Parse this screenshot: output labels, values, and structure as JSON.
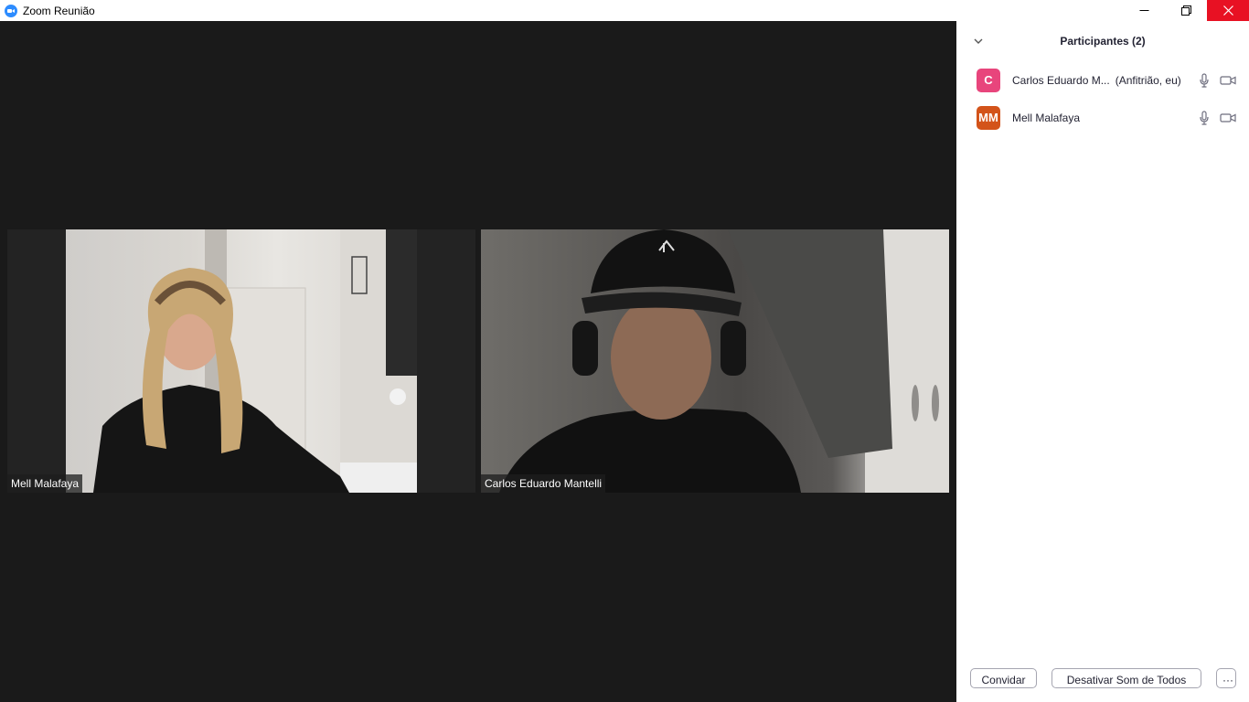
{
  "window": {
    "title": "Zoom Reunião",
    "app_icon": "zoom-camera-icon",
    "controls": [
      "minimize-icon",
      "restore-icon",
      "close-icon"
    ],
    "close_color": "#e81123"
  },
  "gallery": {
    "tiles": [
      {
        "name": "Mell Malafaya"
      },
      {
        "name": "Carlos Eduardo Mantelli"
      }
    ]
  },
  "participants_panel": {
    "title": "Participantes (2)",
    "collapse_icon": "chevron-down-icon",
    "participants": [
      {
        "initials": "C",
        "name": "Carlos Eduardo M...",
        "role": "(Anfitrião, eu)",
        "avatar_color": "#e8457c",
        "mic_icon": "microphone-icon",
        "video_icon": "video-camera-icon"
      },
      {
        "initials": "MM",
        "name": "Mell Malafaya",
        "role": "",
        "avatar_color": "#d3531a",
        "mic_icon": "microphone-icon",
        "video_icon": "video-camera-icon"
      }
    ],
    "footer": {
      "invite_label": "Convidar",
      "mute_all_label": "Desativar Som de Todos",
      "more_label": "···"
    }
  }
}
